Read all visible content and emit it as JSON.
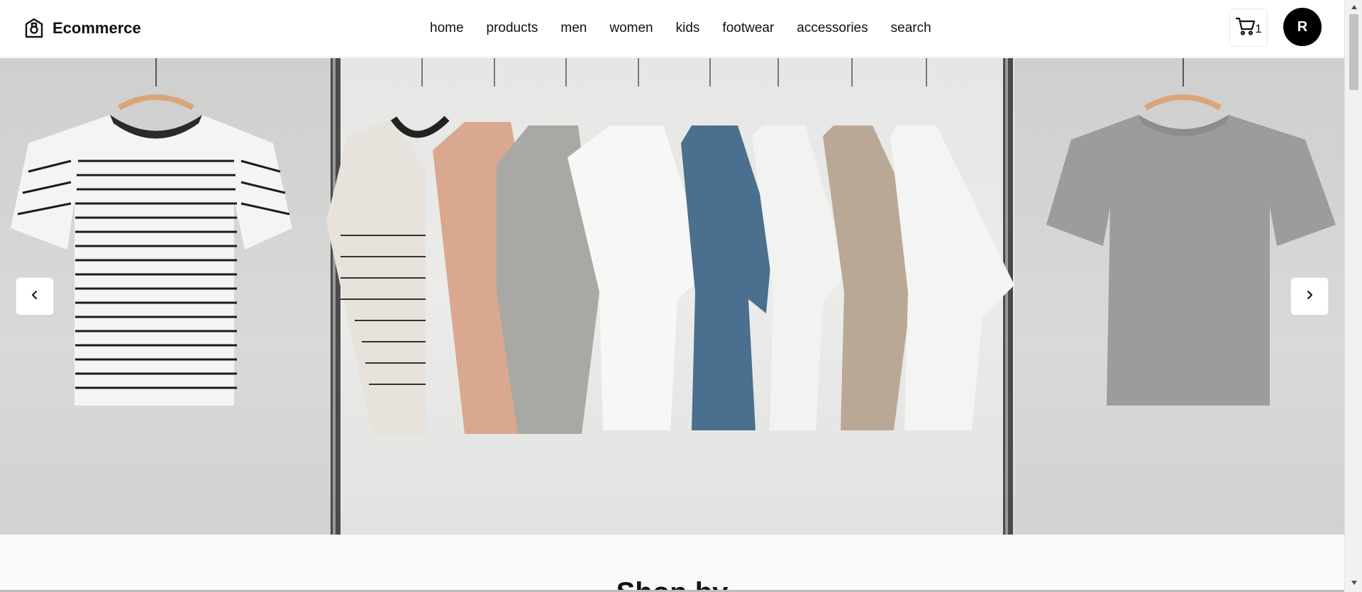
{
  "brand": {
    "name": "Ecommerce",
    "icon": "shopping-bag-icon"
  },
  "nav": {
    "items": [
      {
        "label": "home"
      },
      {
        "label": "products"
      },
      {
        "label": "men"
      },
      {
        "label": "women"
      },
      {
        "label": "kids"
      },
      {
        "label": "footwear"
      },
      {
        "label": "accessories"
      },
      {
        "label": "search"
      }
    ]
  },
  "cart": {
    "icon": "cart-icon",
    "count": "1"
  },
  "user": {
    "avatar_initial": "R",
    "avatar_bg": "#000000"
  },
  "hero": {
    "image_subject": "t-shirts on hangers on a clothing rail",
    "prev_icon": "chevron-left-icon",
    "next_icon": "chevron-right-icon",
    "shirt_colors": [
      "#f3f3f3",
      "#e8e2dc",
      "#d9a88e",
      "#a8a8a4",
      "#f7f7f5",
      "#4a6f8f",
      "#f2f2f0",
      "#b9a896",
      "#f4f4f2"
    ]
  },
  "section": {
    "title": "Shop by"
  }
}
